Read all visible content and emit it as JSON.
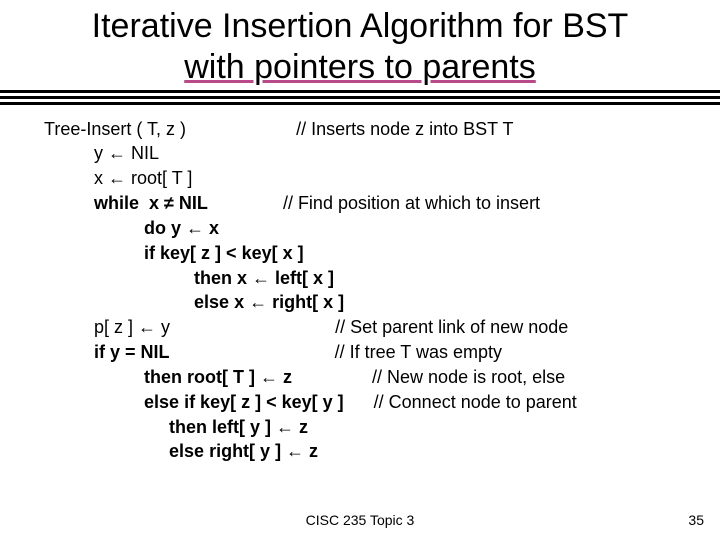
{
  "title_line1": "Iterative Insertion Algorithm for BST",
  "title_line2": "with pointers to parents",
  "code": {
    "l1a": "Tree-Insert ( T, z )",
    "l1b": "// Inserts node z into BST T",
    "l2": "y ← NIL",
    "l3": "x ← root[ T ]",
    "l4a": "while  x ≠ NIL",
    "l4b": "// Find position at which to insert",
    "l5": "do y ← x",
    "l6": "if key[ z ] < key[ x ]",
    "l7": "then x ← left[ x ]",
    "l8": "else x ← right[ x ]",
    "l9a": "p[ z ] ← y",
    "l9b": "// Set parent link of new node",
    "l10a": "if y = NIL",
    "l10b": "// If tree T was empty",
    "l11a": "then root[ T ] ← z",
    "l11b": "// New node is root, else",
    "l12a": "else if key[ z ] < key[ y ]",
    "l12b": "// Connect node to parent",
    "l13": "then left[ y ] ← z",
    "l14": "else right[ y ] ← z"
  },
  "footer": "CISC 235 Topic 3",
  "page": "35"
}
